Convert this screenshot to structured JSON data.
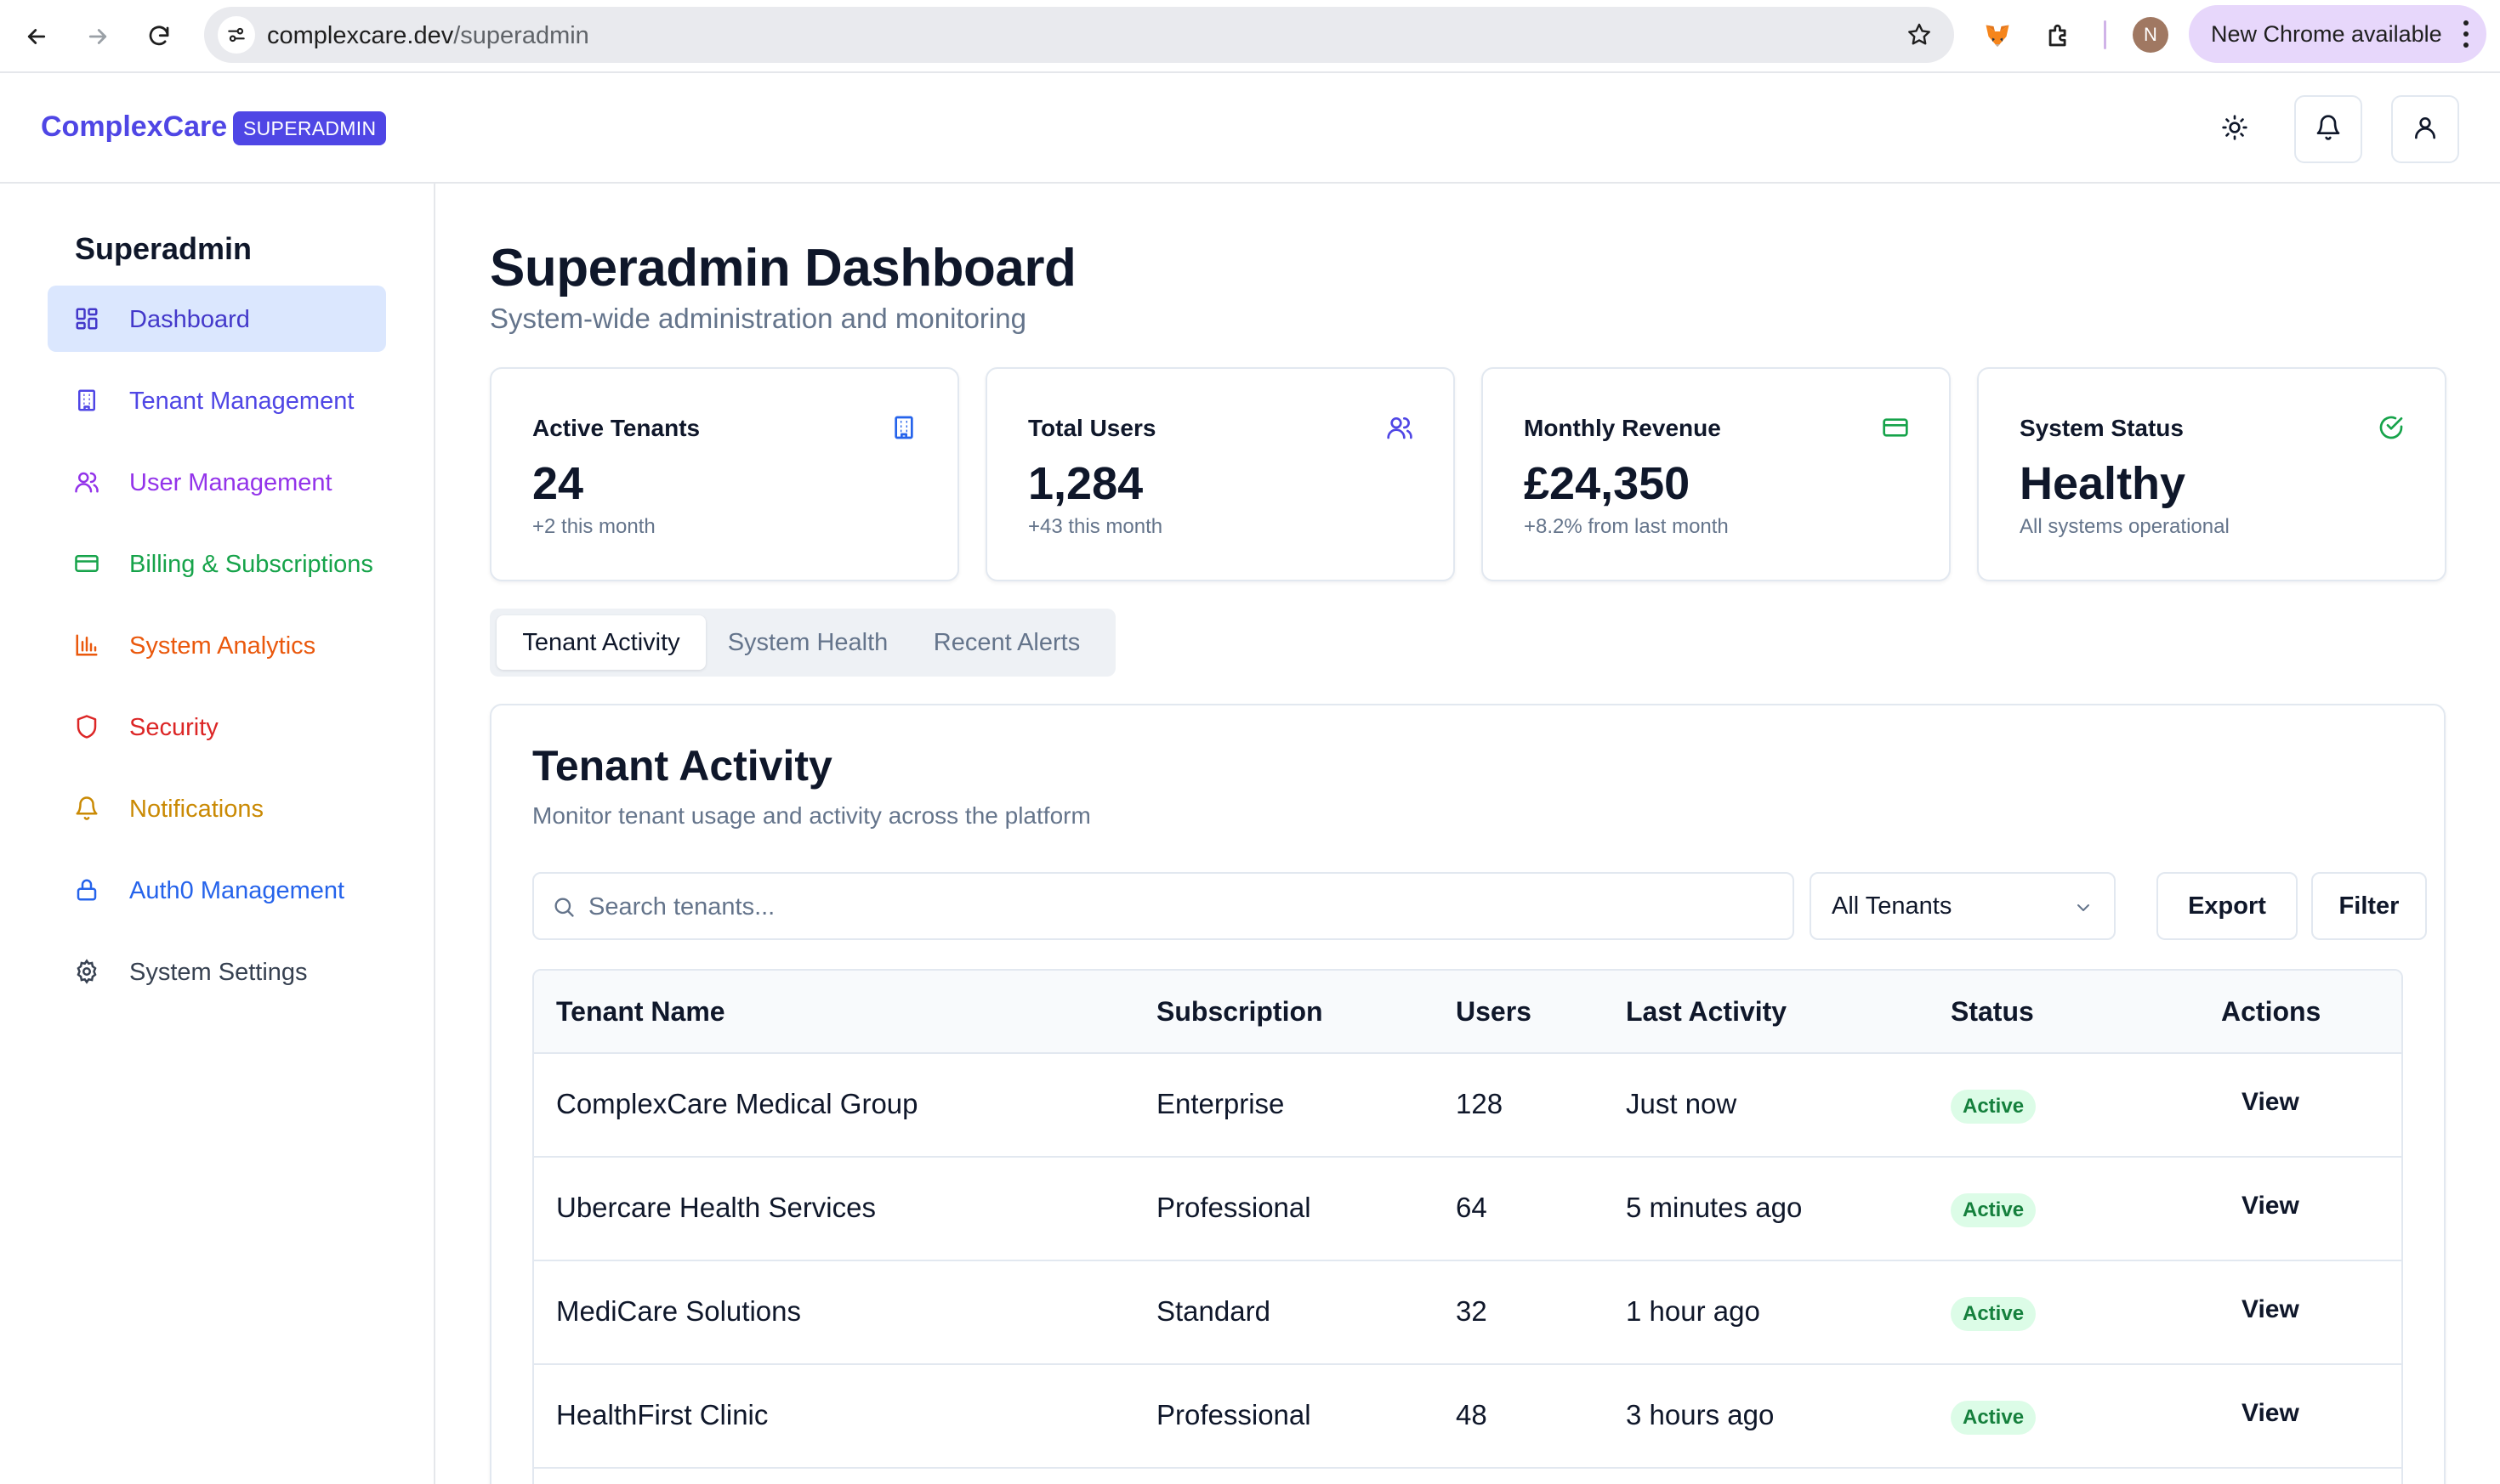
{
  "browser": {
    "url_host": "complexcare.dev",
    "url_path": "/superadmin",
    "profile_initial": "N",
    "new_chrome_label": "New Chrome available"
  },
  "header": {
    "brand": "ComplexCare",
    "role_badge": "SUPERADMIN",
    "brand_color": "#4f46e5"
  },
  "sidebar": {
    "title": "Superadmin",
    "items": [
      {
        "label": "Dashboard",
        "icon": "dashboard-grid-icon",
        "color": "#4338ca",
        "active": true
      },
      {
        "label": "Tenant Management",
        "icon": "building-icon",
        "color": "#4f46e5"
      },
      {
        "label": "User Management",
        "icon": "users-icon",
        "color": "#9333ea"
      },
      {
        "label": "Billing & Subscriptions",
        "icon": "credit-card-icon",
        "color": "#16a34a"
      },
      {
        "label": "System Analytics",
        "icon": "bar-chart-icon",
        "color": "#ea580c"
      },
      {
        "label": "Security",
        "icon": "shield-icon",
        "color": "#dc2626"
      },
      {
        "label": "Notifications",
        "icon": "bell-icon",
        "color": "#ca8a04"
      },
      {
        "label": "Auth0 Management",
        "icon": "lock-icon",
        "color": "#2563eb"
      },
      {
        "label": "System Settings",
        "icon": "gear-icon",
        "color": "#374151"
      }
    ]
  },
  "main": {
    "title": "Superadmin Dashboard",
    "subtitle": "System-wide administration and monitoring"
  },
  "stats": [
    {
      "label": "Active Tenants",
      "value": "24",
      "note": "+2 this month",
      "icon": "building-icon",
      "icon_color": "#2563eb"
    },
    {
      "label": "Total Users",
      "value": "1,284",
      "note": "+43 this month",
      "icon": "users-icon",
      "icon_color": "#4f46e5"
    },
    {
      "label": "Monthly Revenue",
      "value": "£24,350",
      "note": "+8.2% from last month",
      "icon": "credit-card-icon",
      "icon_color": "#16a34a"
    },
    {
      "label": "System Status",
      "value": "Healthy",
      "note": "All systems operational",
      "icon": "check-circle-icon",
      "icon_color": "#16a34a"
    }
  ],
  "tabs": [
    {
      "label": "Tenant Activity",
      "active": true
    },
    {
      "label": "System Health",
      "active": false
    },
    {
      "label": "Recent Alerts",
      "active": false
    }
  ],
  "panel": {
    "title": "Tenant Activity",
    "subtitle": "Monitor tenant usage and activity across the platform",
    "search_placeholder": "Search tenants...",
    "search_value": "",
    "filter_select": "All Tenants",
    "export_label": "Export",
    "filter_label": "Filter"
  },
  "table": {
    "columns": [
      "Tenant Name",
      "Subscription",
      "Users",
      "Last Activity",
      "Status",
      "Actions"
    ],
    "rows": [
      {
        "name": "ComplexCare Medical Group",
        "subscription": "Enterprise",
        "users": "128",
        "last_activity": "Just now",
        "status": "Active",
        "action": "View"
      },
      {
        "name": "Ubercare Health Services",
        "subscription": "Professional",
        "users": "64",
        "last_activity": "5 minutes ago",
        "status": "Active",
        "action": "View"
      },
      {
        "name": "MediCare Solutions",
        "subscription": "Standard",
        "users": "32",
        "last_activity": "1 hour ago",
        "status": "Active",
        "action": "View"
      },
      {
        "name": "HealthFirst Clinic",
        "subscription": "Professional",
        "users": "48",
        "last_activity": "3 hours ago",
        "status": "Active",
        "action": "View"
      }
    ]
  }
}
